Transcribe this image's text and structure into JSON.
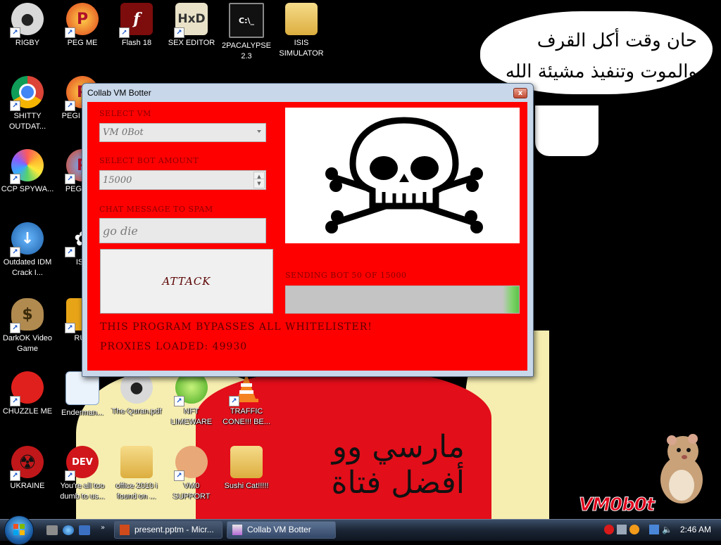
{
  "wallpaper": {
    "bubble_text_line1": "حان وقت أكل القرف",
    "bubble_text_line2": "والموت وتنفيذ مشيئة الله",
    "red_shirt_text": "مارسي وو أفضل فتاة",
    "signature": "VM0b0t"
  },
  "desktop_icons": [
    {
      "label": "RIGBY"
    },
    {
      "label": "PEG ME"
    },
    {
      "label": "Flash 18"
    },
    {
      "label": "SEX EDITOR"
    },
    {
      "label": "2PACALYPSE 2.3"
    },
    {
      "label": "ISIS SIMULATOR"
    },
    {
      "label": "SHITTY OUTDAT..."
    },
    {
      "label": "PEGI WOW"
    },
    {
      "label": "CCP SPYWA..."
    },
    {
      "label": "PEGI NIC"
    },
    {
      "label": "Outdated IDM Crack I..."
    },
    {
      "label": "ISR"
    },
    {
      "label": "DarkOK Video Game"
    },
    {
      "label": "RUS"
    },
    {
      "label": "CHUZZLE ME"
    },
    {
      "label": "Enderman..."
    },
    {
      "label": "The Quran.pdf"
    },
    {
      "label": "NFT LIMEWARE"
    },
    {
      "label": "TRAFFIC CONE!!! BE..."
    },
    {
      "label": "UKRAINE"
    },
    {
      "label": "You're all too dumb to us..."
    },
    {
      "label": "office 2010 i found on ..."
    },
    {
      "label": "VM0 SUPPORT"
    },
    {
      "label": "Sushi Cat!!!!!"
    }
  ],
  "window": {
    "title": "Collab VM Botter",
    "close_glyph": "x",
    "select_vm_label": "SELECT VM",
    "select_vm_value": "VM 0Bot",
    "bot_amount_label": "SELECT BOT AMOUNT",
    "bot_amount_value": "15000",
    "chat_label": "CHAT MESSAGE TO SPAM",
    "chat_value": "go die",
    "attack_label": "ATTACK",
    "sending_label": "SENDING BOT 50 OF 15000",
    "progress_fraction": 0.0033,
    "whitelister_text": "THIS PROGRAM BYPASSES ALL WHITELISTER!",
    "proxies_text": "PROXIES LOADED: 49930"
  },
  "taskbar": {
    "buttons": [
      {
        "label": "present.pptm - Micr..."
      },
      {
        "label": "Collab VM Botter"
      }
    ],
    "clock": "2:46 AM"
  },
  "colors": {
    "window_client": "#ff0000",
    "label_dark_red": "#8a0000",
    "taskbar": "#1b2534"
  }
}
